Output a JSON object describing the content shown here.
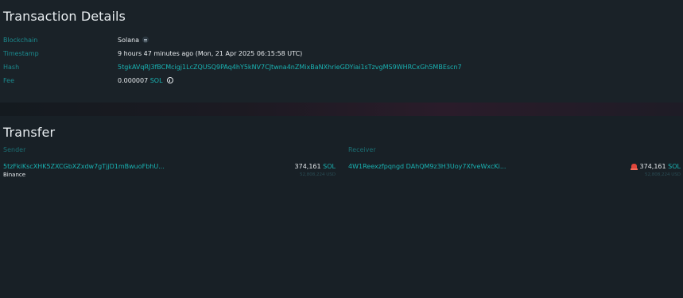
{
  "tx": {
    "title": "Transaction Details",
    "labels": {
      "blockchain": "Blockchain",
      "timestamp": "Timestamp",
      "hash": "Hash",
      "fee": "Fee"
    },
    "blockchain": "Solana",
    "timestamp": "9 hours 47 minutes ago (Mon, 21 Apr 2025 06:15:58 UTC)",
    "hash": "5tgkAVqRJ3fBCMcigj1LcZQUSQ9PAq4hY5kNV7CJtwna4nZMixBaNXhrieGDYiai1sTzvgMS9WHRCxGh5MBEscn7",
    "fee_value": "0.000007",
    "fee_unit": "SOL",
    "icons": {
      "blockchain": "solana-logo-icon",
      "fee": "info-icon"
    }
  },
  "transfer": {
    "title": "Transfer",
    "sender_label": "Sender",
    "receiver_label": "Receiver",
    "sender": {
      "address": "5tzFkiKscXHK5ZXCGbXZxdw7gTjjD1mBwuoFbhU...",
      "entity": "Binance",
      "amount": "374,161",
      "unit": "SOL",
      "usd": "52,808,224 USD"
    },
    "receiver": {
      "address": "4W1Reexzfpqngd DAhQM9z3H3Uoy7XfveWxcKi...",
      "amount": "374,161",
      "unit": "SOL",
      "usd": "52,808,224 USD",
      "icon": "alarm-icon"
    }
  },
  "colors": {
    "accent": "#19b3b3",
    "label": "#1b8a8e",
    "background": "#182026",
    "alert": "#e0463b"
  }
}
